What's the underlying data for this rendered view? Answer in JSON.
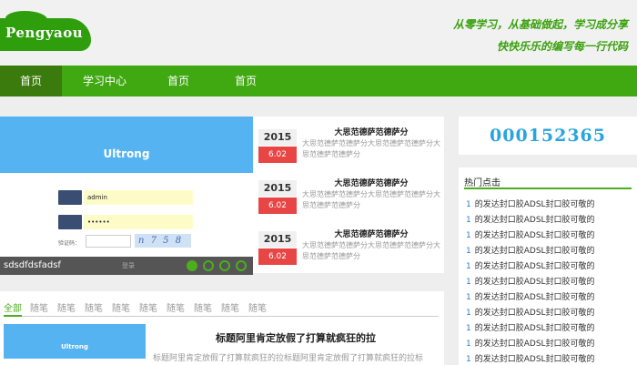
{
  "header": {
    "logo_text": "Pengyaou",
    "slogan_line1": "从零学习，从基础做起，学习成分享",
    "slogan_line2": "快快乐乐的编写每一行代码"
  },
  "nav": {
    "items": [
      {
        "label": "首页",
        "active": true
      },
      {
        "label": "学习中心",
        "active": false
      },
      {
        "label": "首页",
        "active": false
      },
      {
        "label": "首页",
        "active": false
      }
    ]
  },
  "slider": {
    "brand": "Ultrong",
    "username_value": "admin",
    "password_value": "••••••",
    "captcha_label": "验证码：",
    "captcha_text": "n 7 5 8",
    "login_button": "登录",
    "caption": "sdsdfdsfadsf",
    "active_dot": 0,
    "dot_count": 4
  },
  "news": [
    {
      "year": "2015",
      "day": "6.02",
      "title": "大思范德萨范德萨分",
      "desc": "大思范德萨范德萨分大思范德萨范德萨分大思范德萨范德萨分"
    },
    {
      "year": "2015",
      "day": "6.02",
      "title": "大思范德萨范德萨分",
      "desc": "大思范德萨范德萨分大思范德萨范德萨分大思范德萨范德萨分"
    },
    {
      "year": "2015",
      "day": "6.02",
      "title": "大思范德萨范德萨分",
      "desc": "大思范德萨范德萨分大思范德萨范德萨分大思范德萨范德萨分"
    }
  ],
  "counter": "000152365",
  "hot": {
    "title": "热门点击",
    "items": [
      {
        "num": "1",
        "text": "的发达封口胶ADSL封口胶可敬的"
      },
      {
        "num": "1",
        "text": "的发达封口胶ADSL封口胶可敬的"
      },
      {
        "num": "1",
        "text": "的发达封口胶ADSL封口胶可敬的"
      },
      {
        "num": "1",
        "text": "的发达封口胶ADSL封口胶可敬的"
      },
      {
        "num": "1",
        "text": "的发达封口胶ADSL封口胶可敬的"
      },
      {
        "num": "1",
        "text": "的发达封口胶ADSL封口胶可敬的"
      },
      {
        "num": "1",
        "text": "的发达封口胶ADSL封口胶可敬的"
      },
      {
        "num": "1",
        "text": "的发达封口胶ADSL封口胶可敬的"
      },
      {
        "num": "1",
        "text": "的发达封口胶ADSL封口胶可敬的"
      },
      {
        "num": "1",
        "text": "的发达封口胶ADSL封口胶可敬的"
      },
      {
        "num": "1",
        "text": "的发达封口胶ADSL封口胶可敬的"
      }
    ]
  },
  "categories": {
    "tabs": [
      "全部",
      "随笔",
      "随笔",
      "随笔",
      "随笔",
      "随笔",
      "随笔",
      "随笔",
      "随笔",
      "随笔"
    ],
    "active": 0
  },
  "article": {
    "thumb_brand": "Ultrong",
    "title": "标题阿里肯定放假了打算就疯狂的拉",
    "desc": "标题阿里肯定放假了打算就疯狂的拉标题阿里肯定放假了打算就疯狂的拉标"
  }
}
